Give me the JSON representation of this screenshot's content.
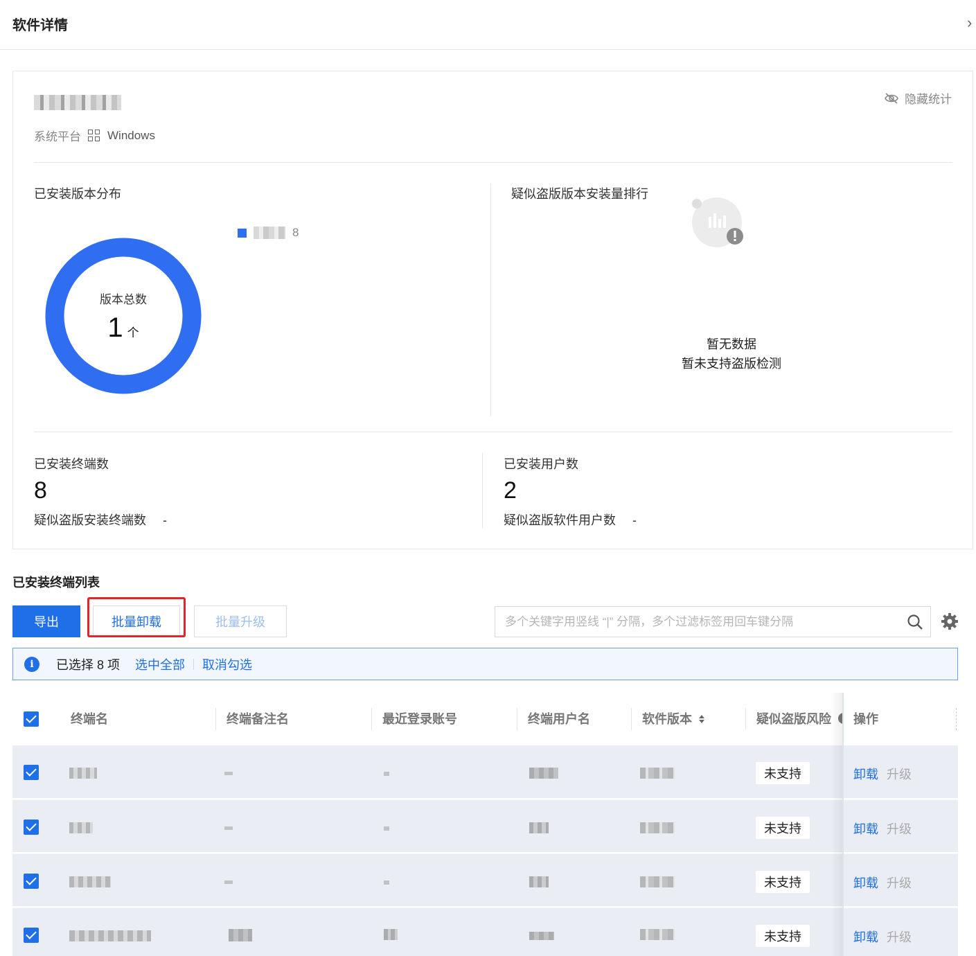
{
  "header": {
    "title": "软件详情",
    "close_icon": "chevron-right-icon"
  },
  "summary": {
    "platform_label": "系统平台",
    "platform_value": "Windows",
    "hide_stats_label": "隐藏统计",
    "version_distribution": {
      "title": "已安装版本分布",
      "donut_label": "版本总数",
      "total": "1",
      "unit": "个",
      "legend": [
        {
          "value": "8",
          "color": "#2f6ef0"
        }
      ]
    },
    "piracy_rank": {
      "title": "疑似盗版版本安装量排行",
      "empty_title": "暂无数据",
      "empty_sub": "暂未支持盗版检测"
    },
    "installed_terminals": {
      "label": "已安装终端数",
      "value": "8",
      "sub_label": "疑似盗版安装终端数",
      "sub_value": "-"
    },
    "installed_users": {
      "label": "已安装用户数",
      "value": "2",
      "sub_label": "疑似盗版软件用户数",
      "sub_value": "-"
    }
  },
  "list": {
    "title": "已安装终端列表",
    "buttons": {
      "export": "导出",
      "batch_uninstall": "批量卸载",
      "batch_upgrade": "批量升级"
    },
    "search_placeholder": "多个关键字用竖线 “|” 分隔，多个过滤标签用回车键分隔",
    "selection": {
      "text": "已选择 8 项",
      "select_all": "选中全部",
      "cancel": "取消勾选"
    },
    "columns": [
      "终端名",
      "终端备注名",
      "最近登录账号",
      "终端用户名",
      "软件版本",
      "疑似盗版风险",
      "操作"
    ],
    "rows": [
      {
        "risk": "未支持",
        "uninstall": "卸载",
        "upgrade": "升级"
      },
      {
        "risk": "未支持",
        "uninstall": "卸载",
        "upgrade": "升级"
      },
      {
        "risk": "未支持",
        "uninstall": "卸载",
        "upgrade": "升级"
      },
      {
        "risk": "未支持",
        "uninstall": "卸载",
        "upgrade": "升级"
      }
    ]
  },
  "colors": {
    "primary": "#1f6fe8",
    "donut": "#2f6ef0",
    "highlight": "#e0262a"
  }
}
